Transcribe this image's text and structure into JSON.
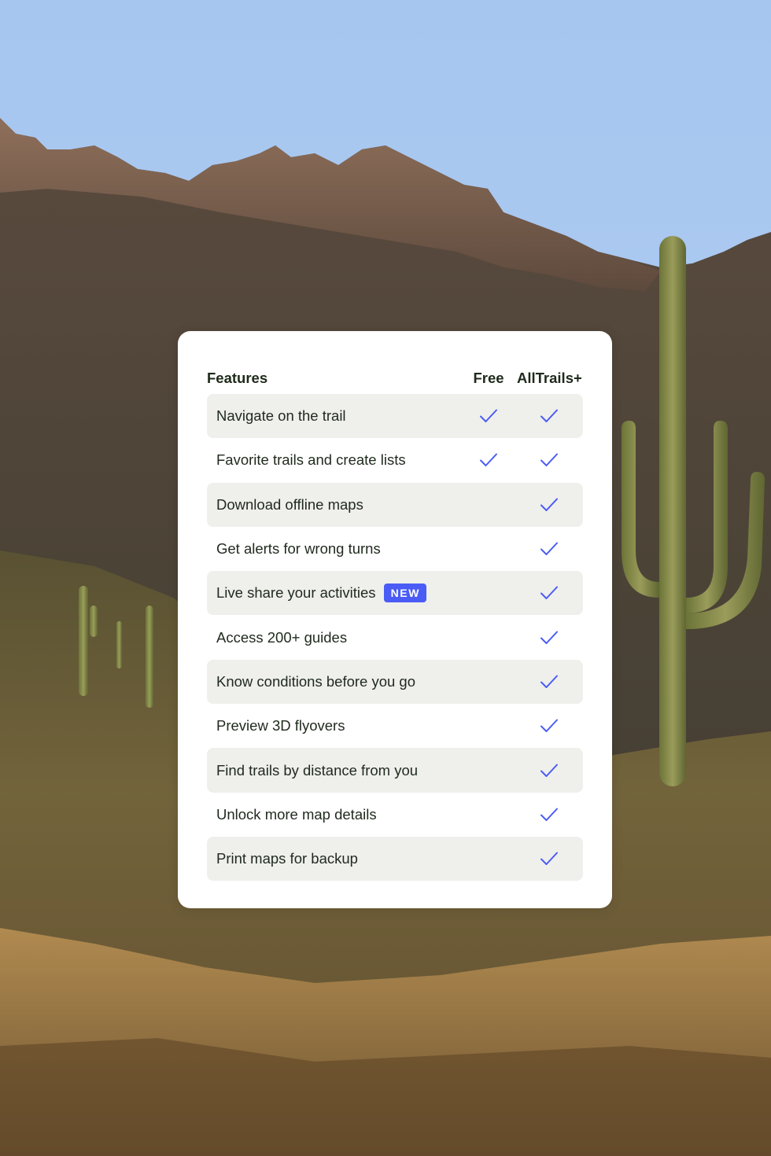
{
  "card": {
    "headers": {
      "features": "Features",
      "free": "Free",
      "plus": "AllTrails+"
    },
    "rows": [
      {
        "label": "Navigate on the trail",
        "free": true,
        "plus": true
      },
      {
        "label": "Favorite trails and create lists",
        "free": true,
        "plus": true
      },
      {
        "label": "Download offline maps",
        "free": false,
        "plus": true
      },
      {
        "label": "Get alerts for wrong turns",
        "free": false,
        "plus": true
      },
      {
        "label": "Live share your activities",
        "badge": "NEW",
        "free": false,
        "plus": true
      },
      {
        "label": "Access 200+ guides",
        "free": false,
        "plus": true
      },
      {
        "label": "Know conditions before you go",
        "free": false,
        "plus": true
      },
      {
        "label": "Preview 3D flyovers",
        "free": false,
        "plus": true
      },
      {
        "label": "Find trails by distance from you",
        "free": false,
        "plus": true
      },
      {
        "label": "Unlock more map details",
        "free": false,
        "plus": true
      },
      {
        "label": "Print maps for backup",
        "free": false,
        "plus": true
      }
    ]
  },
  "colors": {
    "check": "#4a5cf5",
    "badge": "#4a5cf5",
    "row_shade": "#efefec",
    "sky": "#a9c8ef"
  }
}
